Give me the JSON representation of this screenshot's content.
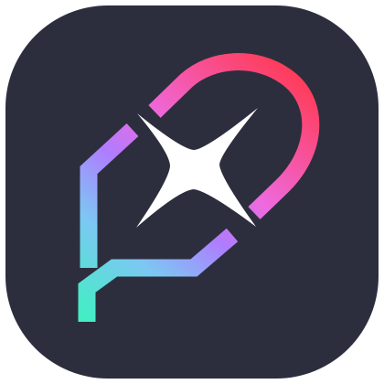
{
  "app_icon": {
    "icon": "sparkle-chat-bubble-icon",
    "background_color": "#2d2e3d",
    "sparkle_color": "#ffffff",
    "gradient_colors": {
      "top_right": "#ff3b57",
      "upper_left": "#ee6adf",
      "middle_left": "#b07cff",
      "lower_left": "#7cc7f3",
      "bottom": "#40f0c2"
    }
  }
}
